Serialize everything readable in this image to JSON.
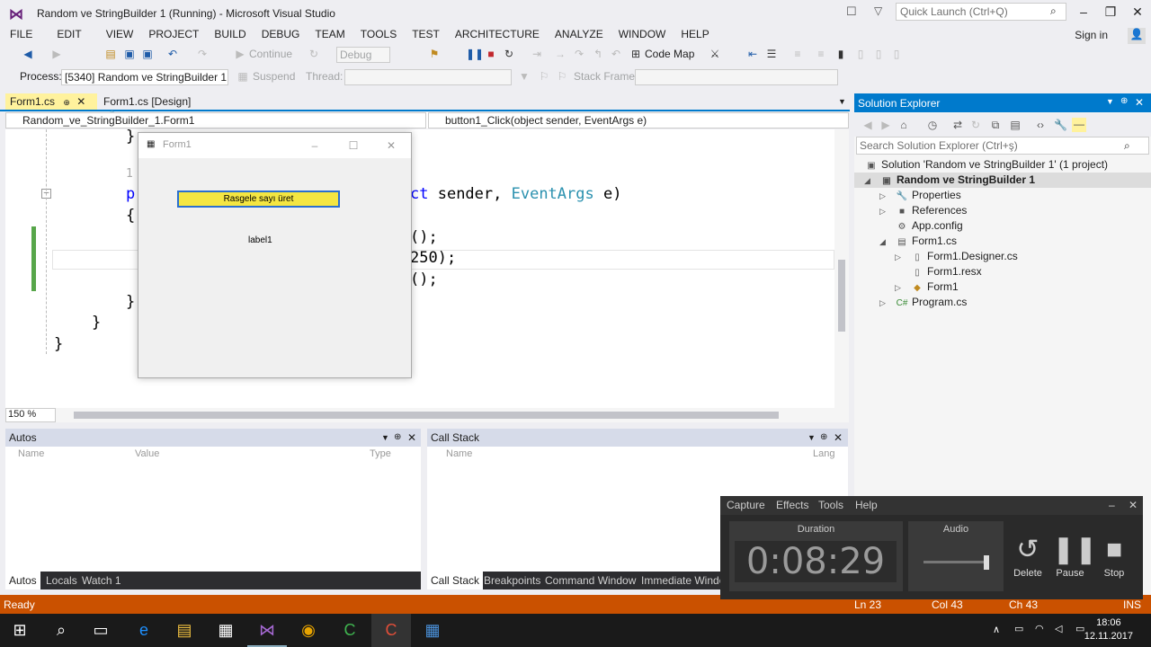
{
  "window": {
    "title": "Random ve StringBuilder 1 (Running) - Microsoft Visual Studio",
    "quick_launch_placeholder": "Quick Launch (Ctrl+Q)",
    "sign_in": "Sign in"
  },
  "menu": [
    "FILE",
    "EDIT",
    "VIEW",
    "PROJECT",
    "BUILD",
    "DEBUG",
    "TEAM",
    "TOOLS",
    "TEST",
    "ARCHITECTURE",
    "ANALYZE",
    "WINDOW",
    "HELP"
  ],
  "toolbar": {
    "continue": "Continue",
    "debug_combo": "Debug",
    "code_map": "Code Map",
    "process_label": "Process:",
    "process_value": "[5340] Random ve StringBuilder 1.(",
    "suspend": "Suspend",
    "thread_label": "Thread:",
    "stack_frame_label": "Stack Frame:"
  },
  "doc_tabs": [
    "Form1.cs",
    "Form1.cs [Design]"
  ],
  "nav": {
    "class_combo": "Random_ve_StringBuilder_1.Form1",
    "member_combo": "button1_Click(object sender, EventArgs e)"
  },
  "code": {
    "line1": "}",
    "ref_count": "1",
    "line_sig_pre": "pr",
    "line_sig_kw": "ct",
    "line_sig_mid": " sender, ",
    "line_sig_type": "EventArgs",
    "line_sig_post": " e)",
    "open_brace": "{",
    "l4": "();",
    "l5": "250);",
    "l6": "();",
    "close1": "}",
    "close2": "}",
    "close3": "}"
  },
  "zoom": "150 %",
  "form1": {
    "title": "Form1",
    "button": "Rasgele sayı üret",
    "label": "label1"
  },
  "solution_explorer": {
    "title": "Solution Explorer",
    "search_placeholder": "Search Solution Explorer (Ctrl+ş)",
    "items": [
      "Solution 'Random ve StringBuilder 1' (1 project)",
      "Random ve StringBuilder 1",
      "Properties",
      "References",
      "App.config",
      "Form1.cs",
      "Form1.Designer.cs",
      "Form1.resx",
      "Form1",
      "Program.cs"
    ]
  },
  "autos": {
    "title": "Autos",
    "cols": [
      "Name",
      "Value",
      "Type"
    ],
    "tabs": [
      "Autos",
      "Locals",
      "Watch 1"
    ]
  },
  "callstack": {
    "title": "Call Stack",
    "cols": [
      "Name",
      "Lang"
    ],
    "tabs": [
      "Call Stack",
      "Breakpoints",
      "Command Window",
      "Immediate Windo"
    ]
  },
  "status": {
    "state": "Ready",
    "ln": "Ln 23",
    "col": "Col 43",
    "ch": "Ch 43",
    "mode": "INS"
  },
  "recorder": {
    "menu": [
      "Capture",
      "Effects",
      "Tools",
      "Help"
    ],
    "duration_label": "Duration",
    "duration": "0:08:29",
    "audio_label": "Audio",
    "delete": "Delete",
    "pause": "Pause",
    "stop": "Stop"
  },
  "clock": {
    "time": "18:06",
    "date": "12.11.2017"
  }
}
